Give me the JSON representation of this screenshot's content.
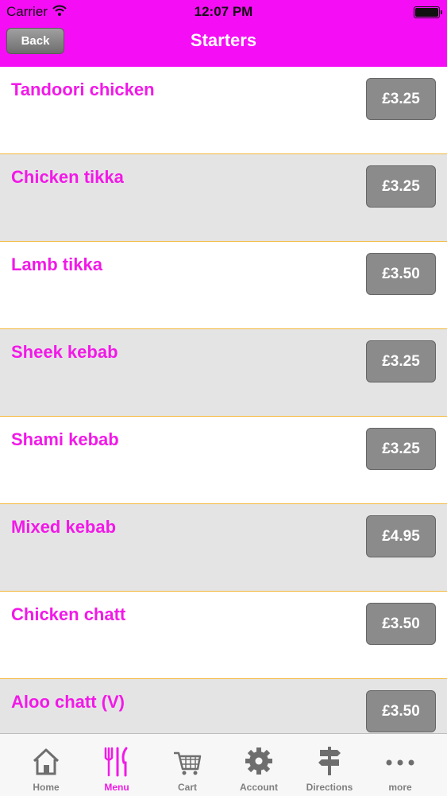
{
  "status_bar": {
    "carrier": "Carrier",
    "time": "12:07 PM"
  },
  "nav": {
    "back_label": "Back",
    "title": "Starters"
  },
  "menu_items": [
    {
      "name": "Tandoori chicken",
      "price": "£3.25"
    },
    {
      "name": "Chicken tikka",
      "price": "£3.25"
    },
    {
      "name": "Lamb tikka",
      "price": "£3.50"
    },
    {
      "name": "Sheek kebab",
      "price": "£3.25"
    },
    {
      "name": "Shami kebab",
      "price": "£3.25"
    },
    {
      "name": "Mixed kebab",
      "price": "£4.95"
    },
    {
      "name": "Chicken chatt",
      "price": "£3.50"
    },
    {
      "name": "Aloo chatt (V)",
      "price": "£3.50"
    }
  ],
  "tabs": [
    {
      "label": "Home",
      "icon": "home-icon"
    },
    {
      "label": "Menu",
      "icon": "cutlery-icon",
      "active": true
    },
    {
      "label": "Cart",
      "icon": "cart-icon"
    },
    {
      "label": "Account",
      "icon": "gear-icon"
    },
    {
      "label": "Directions",
      "icon": "signpost-icon"
    },
    {
      "label": "more",
      "icon": "more-icon"
    }
  ],
  "colors": {
    "brand": "#f50ef5",
    "item_text": "#f219e8",
    "price_button": "#8b8b8b",
    "row_alt": "#e4e4e4",
    "divider": "#f2b73b"
  }
}
